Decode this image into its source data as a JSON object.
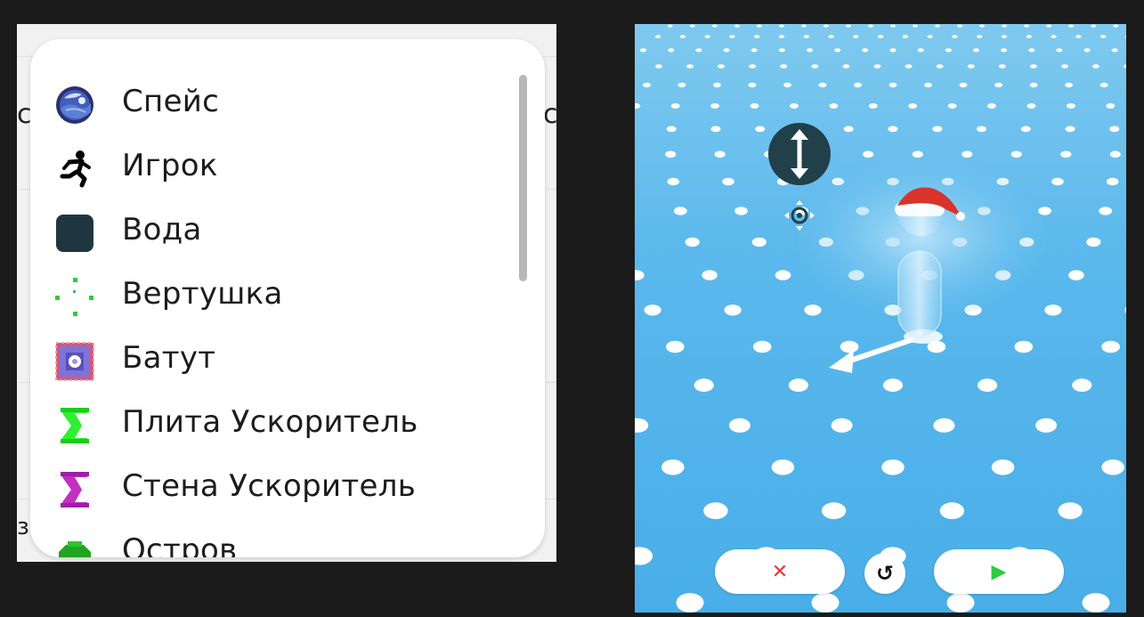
{
  "left_panel": {
    "background_fragments": [
      "c",
      "c",
      "зı"
    ],
    "menu": {
      "items": [
        {
          "label": "Спейс",
          "icon": "planet-icon"
        },
        {
          "label": "Игрок",
          "icon": "running-person-icon"
        },
        {
          "label": "Вода",
          "icon": "water-square-icon"
        },
        {
          "label": "Вертушка",
          "icon": "spinner-dots-icon"
        },
        {
          "label": "Батут",
          "icon": "trampoline-icon"
        },
        {
          "label": "Плита Ускоритель",
          "icon": "booster-plate-icon"
        },
        {
          "label": "Стена Ускоритель",
          "icon": "booster-wall-icon"
        },
        {
          "label": "Остров",
          "icon": "island-icon"
        }
      ]
    }
  },
  "game": {
    "controls": {
      "cancel_symbol": "✕",
      "cancel_color": "#e53935",
      "reset_symbol": "↺",
      "play_symbol": "▶",
      "play_color": "#2ecc40"
    }
  },
  "colors": {
    "background": "#1b1b1b",
    "floor_blue": "#49aee8",
    "dot_white": "#ffffff",
    "gizmo_dark": "#22404a"
  }
}
